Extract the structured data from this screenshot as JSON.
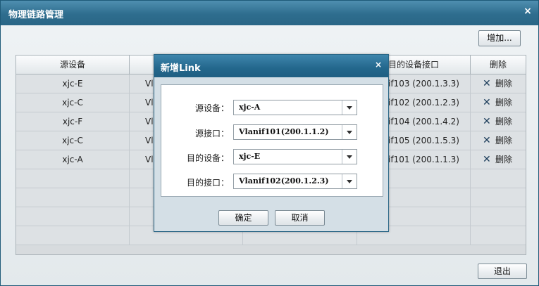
{
  "window": {
    "title": "物理链路管理",
    "close_glyph": "×",
    "add_label": "增加...",
    "exit_label": "退出"
  },
  "table": {
    "columns": [
      "源设备",
      "",
      "",
      "目的设备接口",
      "删除"
    ],
    "rows": [
      {
        "src_device": "xjc-E",
        "src_port": "Vl",
        "dst_port": "if103 (200.1.3.3)",
        "delete": "删除"
      },
      {
        "src_device": "xjc-C",
        "src_port": "Vl",
        "dst_port": "if102 (200.1.2.3)",
        "delete": "删除"
      },
      {
        "src_device": "xjc-F",
        "src_port": "Vl",
        "dst_port": "if104 (200.1.4.2)",
        "delete": "删除"
      },
      {
        "src_device": "xjc-C",
        "src_port": "Vl",
        "dst_port": "if105 (200.1.5.3)",
        "delete": "删除"
      },
      {
        "src_device": "xjc-A",
        "src_port": "Vl",
        "dst_port": "if101 (200.1.1.3)",
        "delete": "删除"
      }
    ]
  },
  "dialog": {
    "title": "新增Link",
    "close_glyph": "×",
    "fields": [
      {
        "label": "源设备：",
        "value": "xjc-A"
      },
      {
        "label": "源接口：",
        "value": "Vlanif101(200.1.1.2)"
      },
      {
        "label": "目的设备：",
        "value": "xjc-E"
      },
      {
        "label": "目的接口：",
        "value": "Vlanif102(200.1.2.3)"
      }
    ],
    "ok_label": "确定",
    "cancel_label": "取消"
  },
  "icons": {
    "delete": "x-icon",
    "dropdown": "chevron-down-icon"
  },
  "colors": {
    "title_bar": "#2e6d8e",
    "dialog_title_bar": "#23678c"
  }
}
